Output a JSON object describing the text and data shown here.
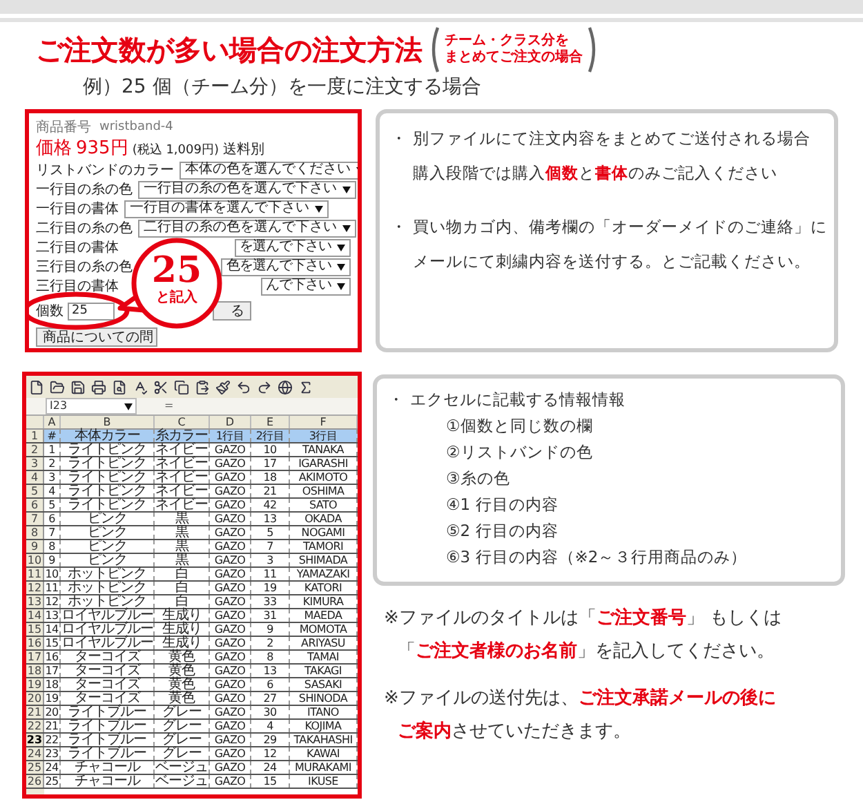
{
  "header": {
    "title": "ご注文数が多い場合の注文方法",
    "aside_lines": [
      "チーム・クラス分を",
      "まとめてご注文の場合"
    ],
    "subtitle": "例）25 個（チーム分）を一度に注文する場合"
  },
  "form": {
    "product_label": "商品番号",
    "product_code": "wristband-4",
    "price_label": "価格",
    "price": "935円",
    "tax_note": "(税込 1,009円)",
    "shipping": "送料別",
    "rows": [
      {
        "label": "リストバンドのカラー",
        "select": "本体の色を選んでください",
        "kind": "full"
      },
      {
        "label": "一行目の糸の色",
        "select": "一行目の糸の色を選んで下さい",
        "kind": "full"
      },
      {
        "label": "一行目の書体",
        "select": "一行目の書体を選んで下さい",
        "kind": "full"
      },
      {
        "label": "二行目の糸の色",
        "select": "二行目の糸の色を選んで下さい",
        "kind": "full"
      },
      {
        "label": "二行目の書体",
        "select": "を選んで下さい",
        "kind": "covered"
      },
      {
        "label": "三行目の糸の色",
        "select": "色を選んで下さい",
        "kind": "covered"
      },
      {
        "label": "三行目の書体",
        "select": "んで下さい",
        "kind": "covered"
      }
    ],
    "quantity_label": "個数",
    "quantity": "25",
    "cart_button": "る",
    "inquiry_button": "商品についての問",
    "callout_number": "25",
    "callout_text": "と記入"
  },
  "info_top": [
    {
      "kind": "bullet",
      "bullet": "・",
      "segments": [
        {
          "text": "別ファイルにて注文内容をまとめてご送付される場合",
          "emphasis": false
        }
      ]
    },
    {
      "kind": "continuation",
      "segments": [
        {
          "text": "購入段階では購入",
          "emphasis": false
        },
        {
          "text": "個数",
          "emphasis": true
        },
        {
          "text": "と",
          "emphasis": false
        },
        {
          "text": "書体",
          "emphasis": true
        },
        {
          "text": "のみご記入ください",
          "emphasis": false
        }
      ]
    },
    {
      "kind": "bullet",
      "bullet": "・",
      "segments": [
        {
          "text": "買い物カゴ内、備考欄の「オーダーメイドのご連絡」に",
          "emphasis": false
        }
      ]
    },
    {
      "kind": "continuation",
      "segments": [
        {
          "text": "メールにて刺繍内容を送付する。とご記載ください。",
          "emphasis": false
        }
      ]
    }
  ],
  "sheet": {
    "name_box": "I23",
    "formula_sign": "=",
    "columns": [
      "A",
      "B",
      "C",
      "D",
      "E",
      "F"
    ],
    "header_row": {
      "n": "1",
      "cells": [
        "#",
        "本体カラー",
        "糸カラー",
        "1行目",
        "2行目",
        "3行目"
      ]
    },
    "rows": [
      {
        "n": "2",
        "cells": [
          "1",
          "ライトピンク",
          "ネイビー",
          "GAZO",
          "10",
          "TANAKA"
        ],
        "selected": false
      },
      {
        "n": "3",
        "cells": [
          "2",
          "ライトピンク",
          "ネイビー",
          "GAZO",
          "17",
          "IGARASHI"
        ],
        "selected": false
      },
      {
        "n": "4",
        "cells": [
          "3",
          "ライトピンク",
          "ネイビー",
          "GAZO",
          "18",
          "AKIMOTO"
        ],
        "selected": false
      },
      {
        "n": "5",
        "cells": [
          "4",
          "ライトピンク",
          "ネイビー",
          "GAZO",
          "21",
          "OSHIMA"
        ],
        "selected": false
      },
      {
        "n": "6",
        "cells": [
          "5",
          "ライトピンク",
          "ネイビー",
          "GAZO",
          "42",
          "SATO"
        ],
        "selected": false
      },
      {
        "n": "7",
        "cells": [
          "6",
          "ピンク",
          "黒",
          "GAZO",
          "13",
          "OKADA"
        ],
        "selected": false
      },
      {
        "n": "8",
        "cells": [
          "7",
          "ピンク",
          "黒",
          "GAZO",
          "5",
          "NOGAMI"
        ],
        "selected": false
      },
      {
        "n": "9",
        "cells": [
          "8",
          "ピンク",
          "黒",
          "GAZO",
          "7",
          "TAMORI"
        ],
        "selected": false
      },
      {
        "n": "10",
        "cells": [
          "9",
          "ピンク",
          "黒",
          "GAZO",
          "3",
          "SHIMADA"
        ],
        "selected": false
      },
      {
        "n": "11",
        "cells": [
          "10",
          "ホットピンク",
          "白",
          "GAZO",
          "11",
          "YAMAZAKI"
        ],
        "selected": false
      },
      {
        "n": "12",
        "cells": [
          "11",
          "ホットピンク",
          "白",
          "GAZO",
          "19",
          "KATORI"
        ],
        "selected": false
      },
      {
        "n": "13",
        "cells": [
          "12",
          "ホットピンク",
          "白",
          "GAZO",
          "33",
          "KIMURA"
        ],
        "selected": false
      },
      {
        "n": "14",
        "cells": [
          "13",
          "ロイヤルブルー",
          "生成り",
          "GAZO",
          "31",
          "MAEDA"
        ],
        "selected": false
      },
      {
        "n": "15",
        "cells": [
          "14",
          "ロイヤルブルー",
          "生成り",
          "GAZO",
          "9",
          "MOMOTA"
        ],
        "selected": false
      },
      {
        "n": "16",
        "cells": [
          "15",
          "ロイヤルブルー",
          "生成り",
          "GAZO",
          "2",
          "ARIYASU"
        ],
        "selected": false
      },
      {
        "n": "17",
        "cells": [
          "16",
          "ターコイズ",
          "黄色",
          "GAZO",
          "8",
          "TAMAI"
        ],
        "selected": false
      },
      {
        "n": "18",
        "cells": [
          "17",
          "ターコイズ",
          "黄色",
          "GAZO",
          "13",
          "TAKAGI"
        ],
        "selected": false
      },
      {
        "n": "19",
        "cells": [
          "18",
          "ターコイズ",
          "黄色",
          "GAZO",
          "6",
          "SASAKI"
        ],
        "selected": false
      },
      {
        "n": "20",
        "cells": [
          "19",
          "ターコイズ",
          "黄色",
          "GAZO",
          "27",
          "SHINODA"
        ],
        "selected": false
      },
      {
        "n": "21",
        "cells": [
          "20",
          "ライトブルー",
          "グレー",
          "GAZO",
          "30",
          "ITANO"
        ],
        "selected": false
      },
      {
        "n": "22",
        "cells": [
          "21",
          "ライトブルー",
          "グレー",
          "GAZO",
          "4",
          "KOJIMA"
        ],
        "selected": false
      },
      {
        "n": "23",
        "cells": [
          "22",
          "ライトブルー",
          "グレー",
          "GAZO",
          "29",
          "TAKAHASHI"
        ],
        "selected": true
      },
      {
        "n": "24",
        "cells": [
          "23",
          "ライトブルー",
          "グレー",
          "GAZO",
          "12",
          "KAWAI"
        ],
        "selected": false
      },
      {
        "n": "25",
        "cells": [
          "24",
          "チャコール",
          "ベージュ",
          "GAZO",
          "24",
          "MURAKAMI"
        ],
        "selected": false
      },
      {
        "n": "26",
        "cells": [
          "25",
          "チャコール",
          "ベージュ",
          "GAZO",
          "15",
          "IKUSE"
        ],
        "selected": false
      }
    ]
  },
  "info_bottom": [
    {
      "kind": "bullet",
      "bullet": "・",
      "segments": [
        {
          "text": "エクセルに記載する情報情報",
          "emphasis": false
        }
      ]
    },
    {
      "kind": "sub",
      "segments": [
        {
          "text": "①個数と同じ数の欄",
          "emphasis": false
        }
      ]
    },
    {
      "kind": "sub",
      "segments": [
        {
          "text": "②リストバンドの色",
          "emphasis": false
        }
      ]
    },
    {
      "kind": "sub",
      "segments": [
        {
          "text": "③糸の色",
          "emphasis": false
        }
      ]
    },
    {
      "kind": "sub",
      "segments": [
        {
          "text": "④1 行目の内容",
          "emphasis": false
        }
      ]
    },
    {
      "kind": "sub",
      "segments": [
        {
          "text": "⑤2 行目の内容",
          "emphasis": false
        }
      ]
    },
    {
      "kind": "sub",
      "segments": [
        {
          "text": "⑥3 行目の内容（※2～３行用商品のみ）",
          "emphasis": false
        }
      ]
    }
  ],
  "notes": [
    [
      {
        "kind": "first",
        "segments": [
          {
            "text": "※ファイルのタイトルは「",
            "emphasis": false
          },
          {
            "text": "ご注文番号",
            "emphasis": true
          },
          {
            "text": "」 もしくは",
            "emphasis": false
          }
        ]
      },
      {
        "kind": "continuation",
        "segments": [
          {
            "text": "「",
            "emphasis": false
          },
          {
            "text": "ご注文者様のお名前",
            "emphasis": true
          },
          {
            "text": "」を記入してください。",
            "emphasis": false
          }
        ]
      }
    ],
    [
      {
        "kind": "first",
        "segments": [
          {
            "text": "※ファイルの送付先は、",
            "emphasis": false
          },
          {
            "text": "ご注文承諾メールの後に",
            "emphasis": true
          }
        ]
      },
      {
        "kind": "continuation",
        "segments": [
          {
            "text": "ご案内",
            "emphasis": true
          },
          {
            "text": "させていただきます。",
            "emphasis": false
          }
        ]
      }
    ]
  ]
}
